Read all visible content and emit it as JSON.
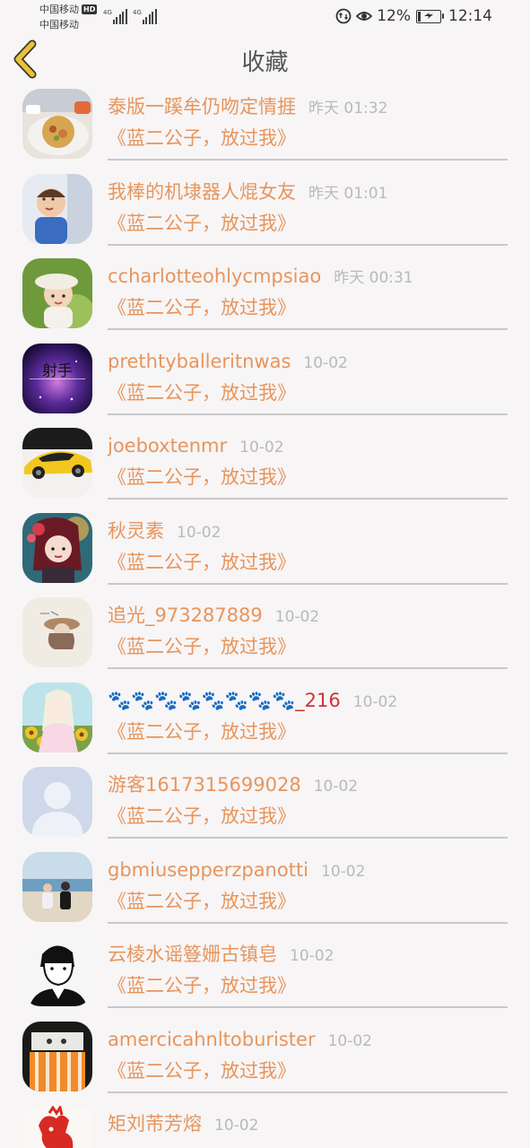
{
  "status_bar": {
    "carrier_1": "中国移动",
    "hd_badge": "HD",
    "carrier_2": "中国移动",
    "net_1": "4G",
    "net_2": "4G",
    "battery": "12%",
    "time": "12:14"
  },
  "header": {
    "title": "收藏"
  },
  "items": [
    {
      "name": "泰版一蹊牟仍吻定情捱",
      "time": "昨天 01:32",
      "subtitle": "《蓝二公子，放过我》"
    },
    {
      "name": "我棒的机埭器人焜女友",
      "time": "昨天 01:01",
      "subtitle": "《蓝二公子，放过我》"
    },
    {
      "name": "ccharlotteohlycmpsiao",
      "time": "昨天 00:31",
      "subtitle": "《蓝二公子，放过我》"
    },
    {
      "name": "prethtyballeritnwas",
      "time": "10-02",
      "subtitle": "《蓝二公子，放过我》"
    },
    {
      "name": "joeboxtenmr",
      "time": "10-02",
      "subtitle": "《蓝二公子，放过我》"
    },
    {
      "name": "秋灵素",
      "time": "10-02",
      "subtitle": "《蓝二公子，放过我》"
    },
    {
      "name": "追光_973287889",
      "time": "10-02",
      "subtitle": "《蓝二公子，放过我》"
    },
    {
      "name": "🐾🐾🐾🐾🐾🐾🐾🐾_216",
      "time": "10-02",
      "subtitle": "《蓝二公子，放过我》"
    },
    {
      "name": "游客1617315699028",
      "time": "10-02",
      "subtitle": "《蓝二公子，放过我》"
    },
    {
      "name": "gbmiusepperzpanotti",
      "time": "10-02",
      "subtitle": "《蓝二公子，放过我》"
    },
    {
      "name": "云棱水谣簦姗古镇皂",
      "time": "10-02",
      "subtitle": "《蓝二公子，放过我》"
    },
    {
      "name": "amercicahnltoburister",
      "time": "10-02",
      "subtitle": "《蓝二公子，放过我》"
    },
    {
      "name": "矩刘芾芳熔",
      "time": "10-02",
      "subtitle": ""
    }
  ],
  "avatar_art": [
    "food-photo",
    "child-photo",
    "girl-hat-photo",
    "purple-galaxy-sagittarius",
    "yellow-sports-car",
    "anime-girl-flowers",
    "girl-hat-sketch",
    "anime-girl-sunflowers",
    "default-user-silhouette",
    "couple-beach-photo",
    "sketch-boy-portrait",
    "orange-striped-fabric",
    "red-paper-cut-rooster"
  ],
  "avatar_label": "射手",
  "colors": {
    "accent": "#e7955c",
    "back_arrow": "#e8c33a",
    "muted": "#b9b9b9"
  }
}
